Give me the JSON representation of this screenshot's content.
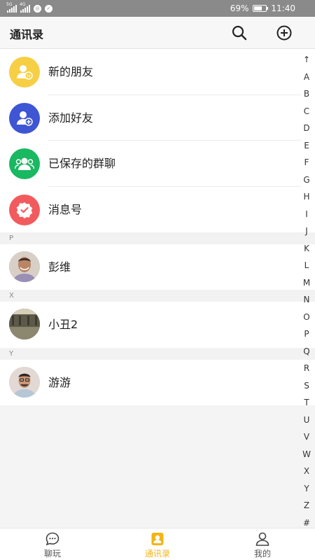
{
  "status_bar": {
    "network_1": "5G",
    "network_2": "4G",
    "battery": "69%",
    "battery_level": 0.69,
    "time": "11:40"
  },
  "header": {
    "title": "通讯录"
  },
  "features": [
    {
      "label": "新的朋友",
      "icon": "new-friend-icon",
      "color": "#f7cf45"
    },
    {
      "label": "添加好友",
      "icon": "add-friend-icon",
      "color": "#3e55d4"
    },
    {
      "label": "已保存的群聊",
      "icon": "group-chat-icon",
      "color": "#19b861"
    },
    {
      "label": "消息号",
      "icon": "message-account-icon",
      "color": "#f25b5d"
    }
  ],
  "sections": [
    {
      "letter": "P",
      "contacts": [
        {
          "name": "彭维"
        }
      ]
    },
    {
      "letter": "X",
      "contacts": [
        {
          "name": "小丑2"
        }
      ]
    },
    {
      "letter": "Y",
      "contacts": [
        {
          "name": "游游"
        }
      ]
    }
  ],
  "index_letters": [
    "↑",
    "A",
    "B",
    "C",
    "D",
    "E",
    "F",
    "G",
    "H",
    "I",
    "J",
    "K",
    "L",
    "M",
    "N",
    "O",
    "P",
    "Q",
    "R",
    "S",
    "T",
    "U",
    "V",
    "W",
    "X",
    "Y",
    "Z",
    "#"
  ],
  "tabs": [
    {
      "label": "聊玩",
      "icon": "chat-bubble-icon",
      "active": false
    },
    {
      "label": "通讯录",
      "icon": "contacts-icon",
      "active": true
    },
    {
      "label": "我的",
      "icon": "profile-icon",
      "active": false
    }
  ],
  "colors": {
    "accent": "#f2b418",
    "status_bar": "#8a8a8a"
  }
}
